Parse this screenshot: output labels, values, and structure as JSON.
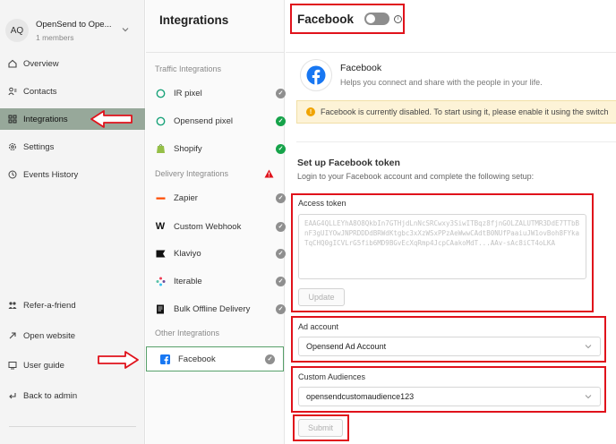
{
  "workspace": {
    "initials": "AQ",
    "name": "OpenSend to Ope...",
    "members": "1 members"
  },
  "sidebar": {
    "items": [
      {
        "label": "Overview",
        "icon": "home-icon"
      },
      {
        "label": "Contacts",
        "icon": "contacts-icon"
      },
      {
        "label": "Integrations",
        "icon": "grid-icon",
        "active": true
      },
      {
        "label": "Settings",
        "icon": "gear-icon"
      },
      {
        "label": "Events History",
        "icon": "history-icon"
      }
    ],
    "bottom_items": [
      {
        "label": "Refer-a-friend",
        "icon": "people-icon"
      },
      {
        "label": "Open website",
        "icon": "external-link-icon"
      },
      {
        "label": "User guide",
        "icon": "book-icon"
      },
      {
        "label": "Back to admin",
        "icon": "back-arrow-icon"
      }
    ]
  },
  "integrations_panel": {
    "title": "Integrations",
    "groups": [
      {
        "label": "Traffic Integrations",
        "items": [
          {
            "label": "IR pixel",
            "status": "grey"
          },
          {
            "label": "Opensend pixel",
            "status": "green"
          },
          {
            "label": "Shopify",
            "status": "green"
          }
        ]
      },
      {
        "label": "Delivery Integrations",
        "warning": true,
        "items": [
          {
            "label": "Zapier",
            "status": "grey"
          },
          {
            "label": "Custom Webhook",
            "status": "grey"
          },
          {
            "label": "Klaviyo",
            "status": "grey"
          },
          {
            "label": "Iterable",
            "status": "grey"
          },
          {
            "label": "Bulk Offline Delivery",
            "status": "grey"
          }
        ]
      },
      {
        "label": "Other Integrations",
        "items": [
          {
            "label": "Facebook",
            "status": "grey",
            "selected": true
          }
        ]
      }
    ]
  },
  "main": {
    "title": "Facebook",
    "enabled": false,
    "integration_name": "Facebook",
    "integration_desc": "Helps you connect and share with the people in your life.",
    "alert": "Facebook is currently disabled. To start using it, please enable it using the switch",
    "setup_title": "Set up Facebook token",
    "setup_desc": "Login to your Facebook account and complete the following setup:",
    "access_token_label": "Access token",
    "access_token_value": "EAAG4QLLEYhA8O8QkbIn7GTHjdLnNcSRCwxy3SiwITBqz8fjnGOLZALUTMR3DdE7TTbBnF3gUIYOwJNPRDDDdBRWdKtgbc3xXzWSxPPzAeWwwCAdtB0NUfPaaiuJW1ovBoh8FYkaTqCHQ0gICVLrG5fib6MD9BGvEcXqRmp4JcpCAakoMdT...AAv-sAc8iCT4oLKA",
    "update_label": "Update",
    "ad_account_label": "Ad account",
    "ad_account_value": "Opensend Ad Account",
    "custom_audiences_label": "Custom Audiences",
    "custom_audiences_value": "opensendcustomaudience123",
    "submit_label": "Submit"
  },
  "colors": {
    "annotation_red": "#e0121b",
    "active_nav": "#97a89a",
    "success_green": "#16a34a",
    "warning_orange": "#f0a400",
    "facebook_blue": "#1877f2"
  }
}
